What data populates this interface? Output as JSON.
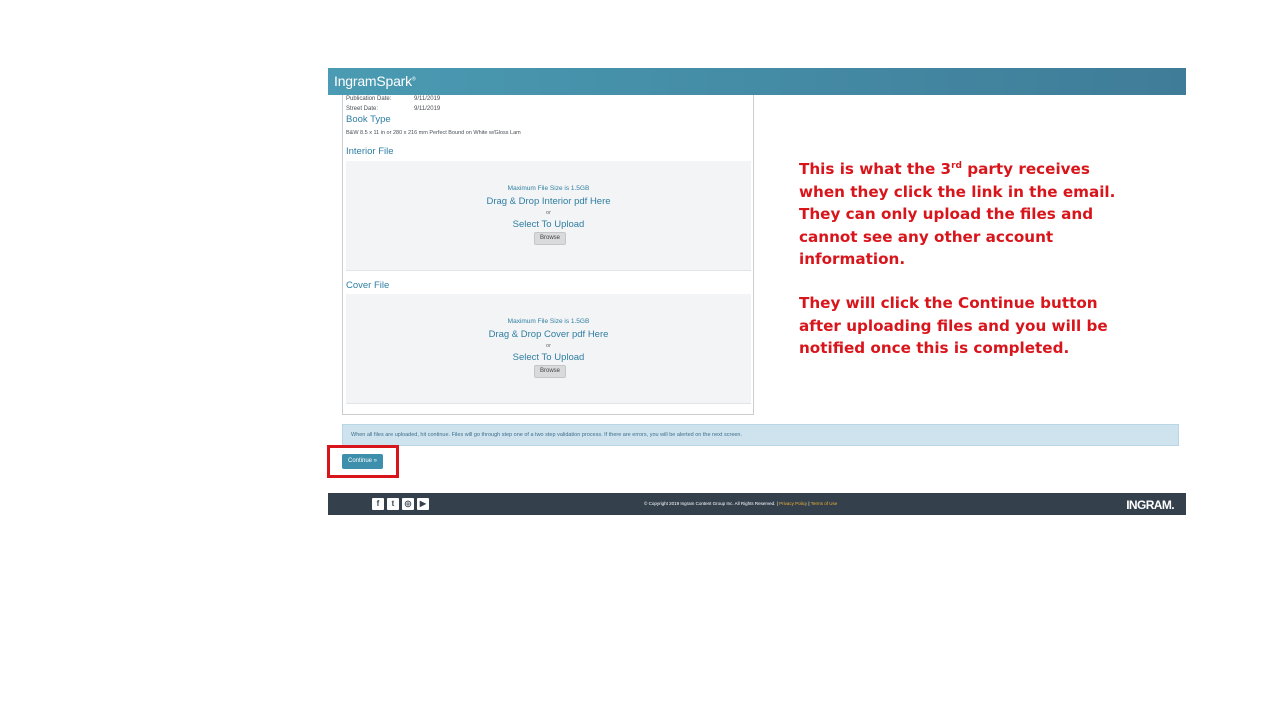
{
  "app": {
    "brand": "IngramSpark",
    "brand_mark": "®"
  },
  "details": {
    "publication_date_label": "Publication Date:",
    "publication_date_value": "9/11/2019",
    "street_date_label": "Street Date:",
    "street_date_value": "9/11/2019",
    "book_type_heading": "Book Type",
    "book_type_value": "B&W 8.5 x 11 in or 280 x 216 mm Perfect Bound on White w/Gloss Lam"
  },
  "interior": {
    "heading": "Interior File",
    "max_size": "Maximum File Size is 1.5GB",
    "drag_text": "Drag & Drop Interior pdf Here",
    "or": "or",
    "select_text": "Select To Upload",
    "browse_label": "Browse"
  },
  "cover": {
    "heading": "Cover File",
    "max_size": "Maximum File Size is 1.5GB",
    "drag_text": "Drag & Drop Cover pdf Here",
    "or": "or",
    "select_text": "Select To Upload",
    "browse_label": "Browse"
  },
  "notice": {
    "text": "When all files are uploaded, hit continue. Files will go through step one of a two step validation process. If there are errors, you will be alerted on the next screen."
  },
  "continue_label": "Continue »",
  "footer": {
    "social_icons": [
      "facebook-icon",
      "twitter-icon",
      "instagram-icon",
      "youtube-icon"
    ],
    "copyright": "© Copyright 2019 Ingram Content Group Inc. All Rights Reserved. |",
    "privacy_link": "Privacy Policy",
    "separator": "|",
    "terms_link": "Terms of Use",
    "logo": "INGRAM."
  },
  "annotation": {
    "p1_part1": "This is what the 3",
    "p1_sup": "rd",
    "p1_part2": " party receives when they click the link in the email. They can only upload the files and cannot see any other account information.",
    "p2": "They will click the Continue button after uploading files and you will be notified once this is completed."
  },
  "colors": {
    "header_start": "#4a9bb3",
    "header_end": "#3f7c98",
    "link_blue": "#2f7ea3",
    "footer_bg": "#34414d",
    "annotation_red": "#d9151c",
    "notice_bg": "#cfe3ee",
    "continue_bg": "#3d8fab"
  }
}
